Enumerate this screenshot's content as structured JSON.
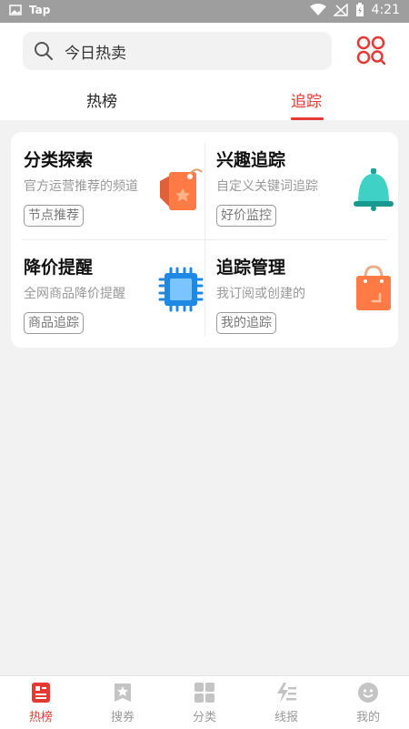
{
  "status_bar": {
    "carrier": "Tap",
    "time": "4:21"
  },
  "search": {
    "placeholder": "今日热卖"
  },
  "tabs": [
    {
      "label": "热榜",
      "active": false
    },
    {
      "label": "追踪",
      "active": true
    }
  ],
  "features": [
    {
      "title": "分类探索",
      "subtitle": "官方运营推荐的频道",
      "tag": "节点推荐",
      "icon": "price-tag-icon"
    },
    {
      "title": "兴趣追踪",
      "subtitle": "自定义关键词追踪",
      "tag": "好价监控",
      "icon": "bell-icon"
    },
    {
      "title": "降价提醒",
      "subtitle": "全网商品降价提醒",
      "tag": "商品追踪",
      "icon": "chip-icon"
    },
    {
      "title": "追踪管理",
      "subtitle": "我订阅或创建的",
      "tag": "我的追踪",
      "icon": "shopping-bag-icon"
    }
  ],
  "bottom_nav": [
    {
      "label": "热榜",
      "icon": "hot-list-icon",
      "active": true
    },
    {
      "label": "搜券",
      "icon": "coupon-star-icon",
      "active": false
    },
    {
      "label": "分类",
      "icon": "category-grid-icon",
      "active": false
    },
    {
      "label": "线报",
      "icon": "news-bolt-icon",
      "active": false
    },
    {
      "label": "我的",
      "icon": "profile-face-icon",
      "active": false
    }
  ],
  "colors": {
    "accent": "#e53935",
    "background": "#f2f2f2"
  }
}
